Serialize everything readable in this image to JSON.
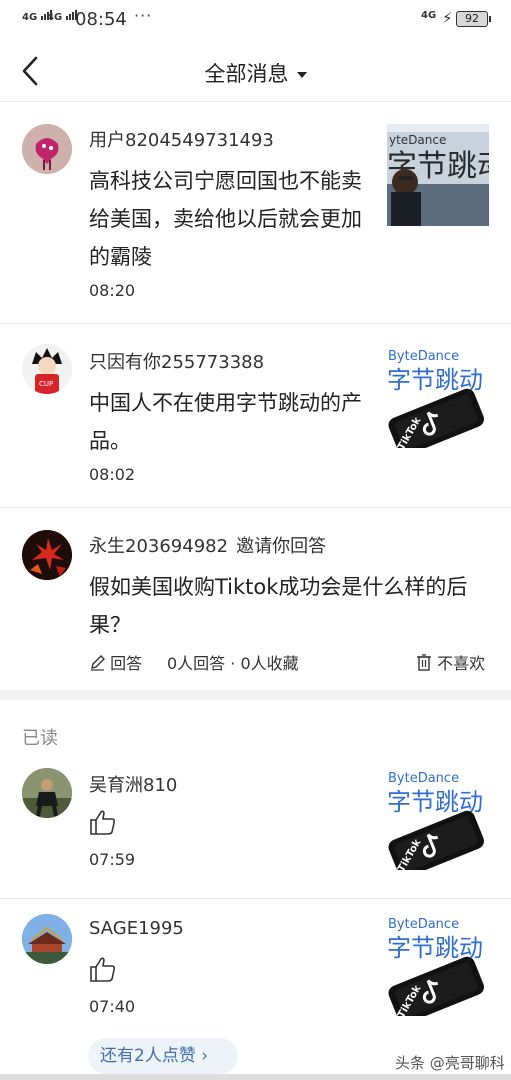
{
  "status_bar": {
    "network_left_1": "4G",
    "network_left_2": "4G",
    "time": "08:54",
    "more": "···",
    "network_right": "4G",
    "battery": "92"
  },
  "nav": {
    "title": "全部消息"
  },
  "messages": [
    {
      "user": "用户8204549731493",
      "text": "高科技公司宁愿回国也不能卖给美国，卖给他以后就会更加的霸陵",
      "time": "08:20",
      "thumb_text": "yteDance"
    },
    {
      "user": "只因有你255773388",
      "text": "中国人不在使用字节跳动的产品。",
      "time": "08:02",
      "thumb_brand": "ByteDance",
      "thumb_cn": "字节跳动",
      "thumb_app": "TikTok"
    },
    {
      "user": "永生203694982",
      "invite": "邀请你回答",
      "text": "假如美国收购Tiktok成功会是什么样的后果？",
      "answer_label": "回答",
      "counts": "0人回答 · 0人收藏",
      "dislike_label": "不喜欢"
    }
  ],
  "read_section": {
    "label": "已读",
    "items": [
      {
        "user": "吴育洲810",
        "time": "07:59",
        "thumb_brand": "ByteDance",
        "thumb_cn": "字节跳动",
        "thumb_app": "TikTok"
      },
      {
        "user": "SAGE1995",
        "time": "07:40",
        "thumb_brand": "ByteDance",
        "thumb_cn": "字节跳动",
        "thumb_app": "TikTok"
      }
    ],
    "more_likes": "还有2人点赞 ›"
  },
  "watermark": "头条 @亮哥聊科技",
  "colors": {
    "accent_blue": "#3f6fad",
    "pill_bg": "#eef3fa",
    "divider": "#e6e6e6",
    "brand_blue": "#2f6fd0"
  }
}
